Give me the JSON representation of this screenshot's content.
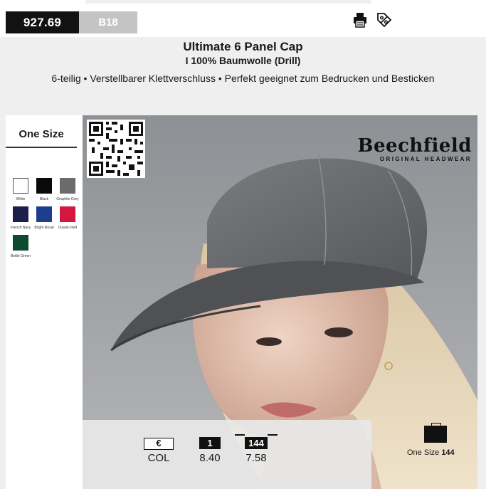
{
  "product": {
    "price_code": "927.69",
    "brand_code": "B18",
    "title": "Ultimate 6 Panel Cap",
    "subtitle": "I 100% Baumwolle (Drill)",
    "features": "6-teilig • Verstellbarer Klettverschluss • Perfekt geeignet zum Bedrucken und Besticken"
  },
  "toolbar": {
    "print_icon": "printer-icon",
    "discount_icon": "percent-tag-icon"
  },
  "sidebar": {
    "size_label": "One Size",
    "colors": [
      {
        "name": "White",
        "hex": "#ffffff"
      },
      {
        "name": "Black",
        "hex": "#0a0a0a"
      },
      {
        "name": "Graphite Grey",
        "hex": "#6b6b6b"
      },
      {
        "name": "French Navy",
        "hex": "#1b1f4a"
      },
      {
        "name": "Bright Royal",
        "hex": "#1e3d8f"
      },
      {
        "name": "Classic Red",
        "hex": "#d4173f"
      },
      {
        "name": "Bottle Green",
        "hex": "#0d4a30"
      }
    ]
  },
  "logo": {
    "name": "Beechfield",
    "tagline": "ORIGINAL HEADWEAR"
  },
  "pricing": {
    "currency_symbol": "€",
    "qty_tier_1": "1",
    "qty_tier_2": "144",
    "row_label": "COL",
    "price_tier_1": "8.40",
    "price_tier_2": "7.58"
  },
  "packaging": {
    "size": "One Size",
    "quantity": "144"
  },
  "colors": {
    "dark": "#121212",
    "brand_code_bg": "#c4c4c4",
    "panel_bg": "#efefef"
  }
}
